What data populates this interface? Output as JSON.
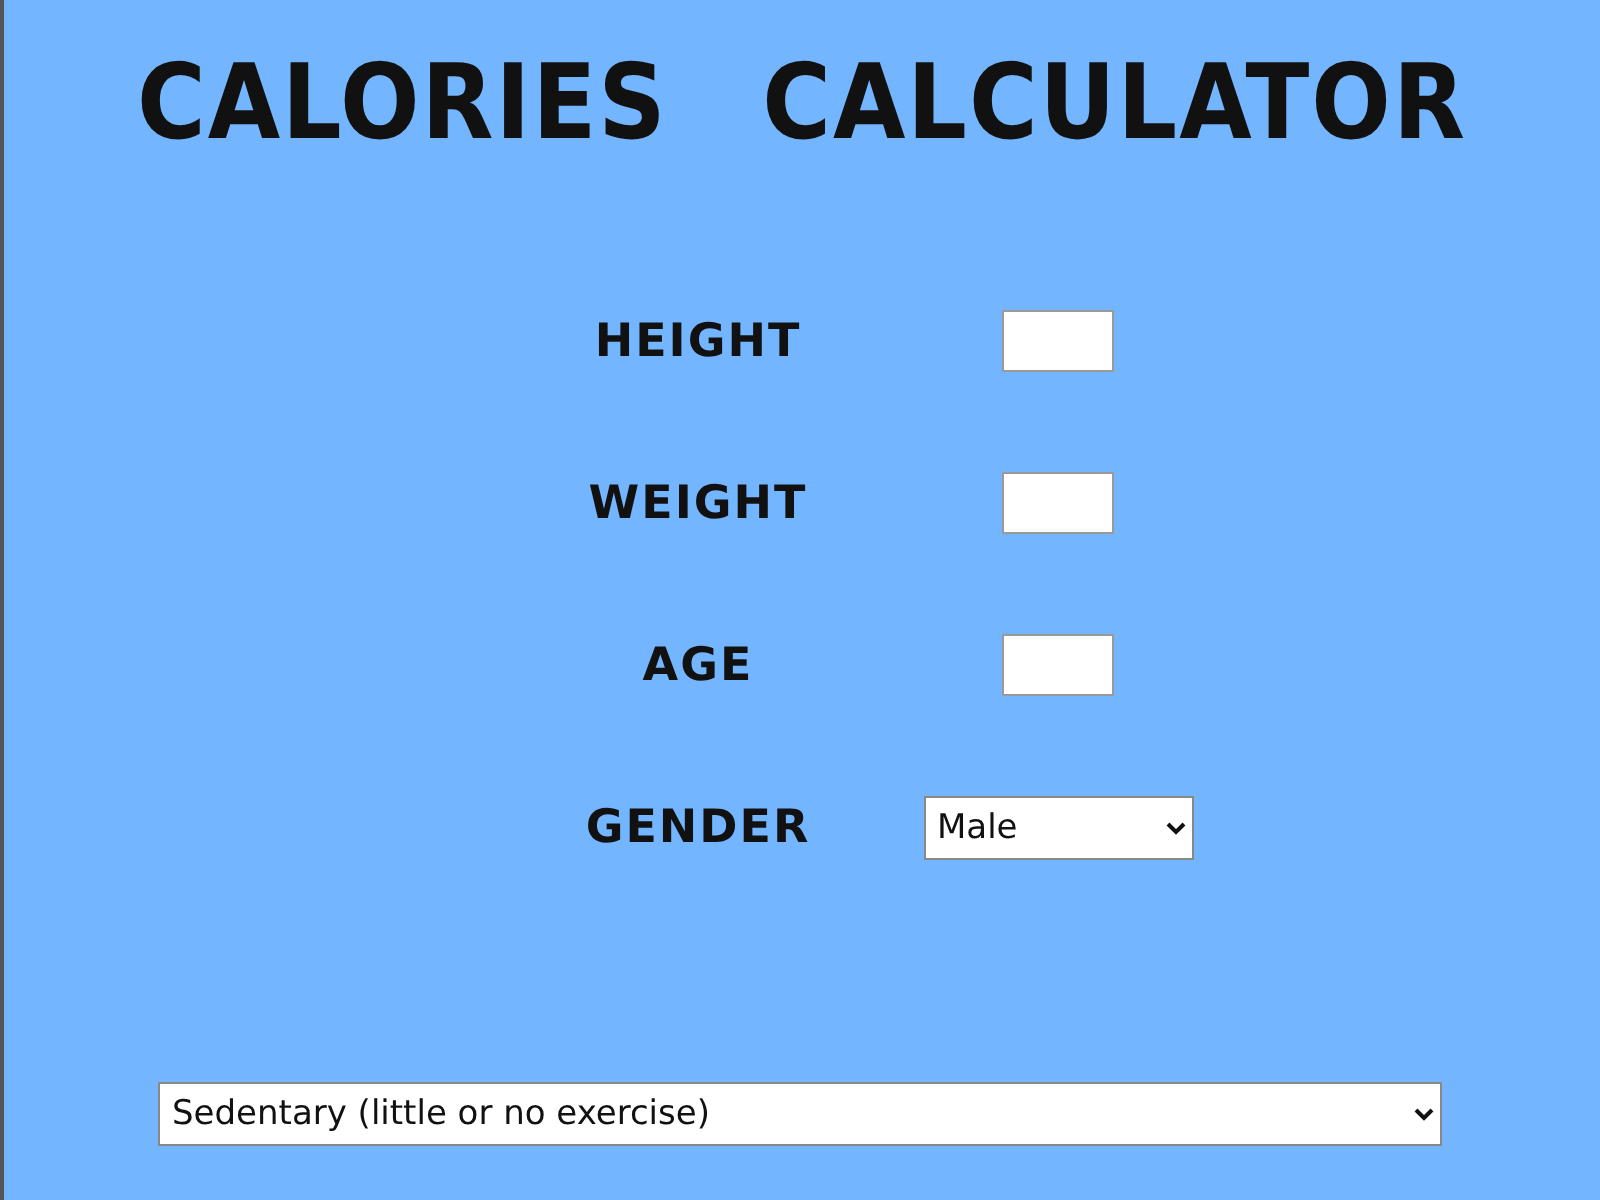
{
  "title": "CALORIES CALCULATOR",
  "fields": [
    {
      "label": "HEIGHT",
      "kind": "text"
    },
    {
      "label": "WEIGHT",
      "kind": "text"
    },
    {
      "label": "AGE",
      "kind": "text"
    },
    {
      "label": "GENDER",
      "kind": "select",
      "value": "Male"
    }
  ],
  "activity": {
    "value": "Sedentary (little or no exercise)"
  }
}
